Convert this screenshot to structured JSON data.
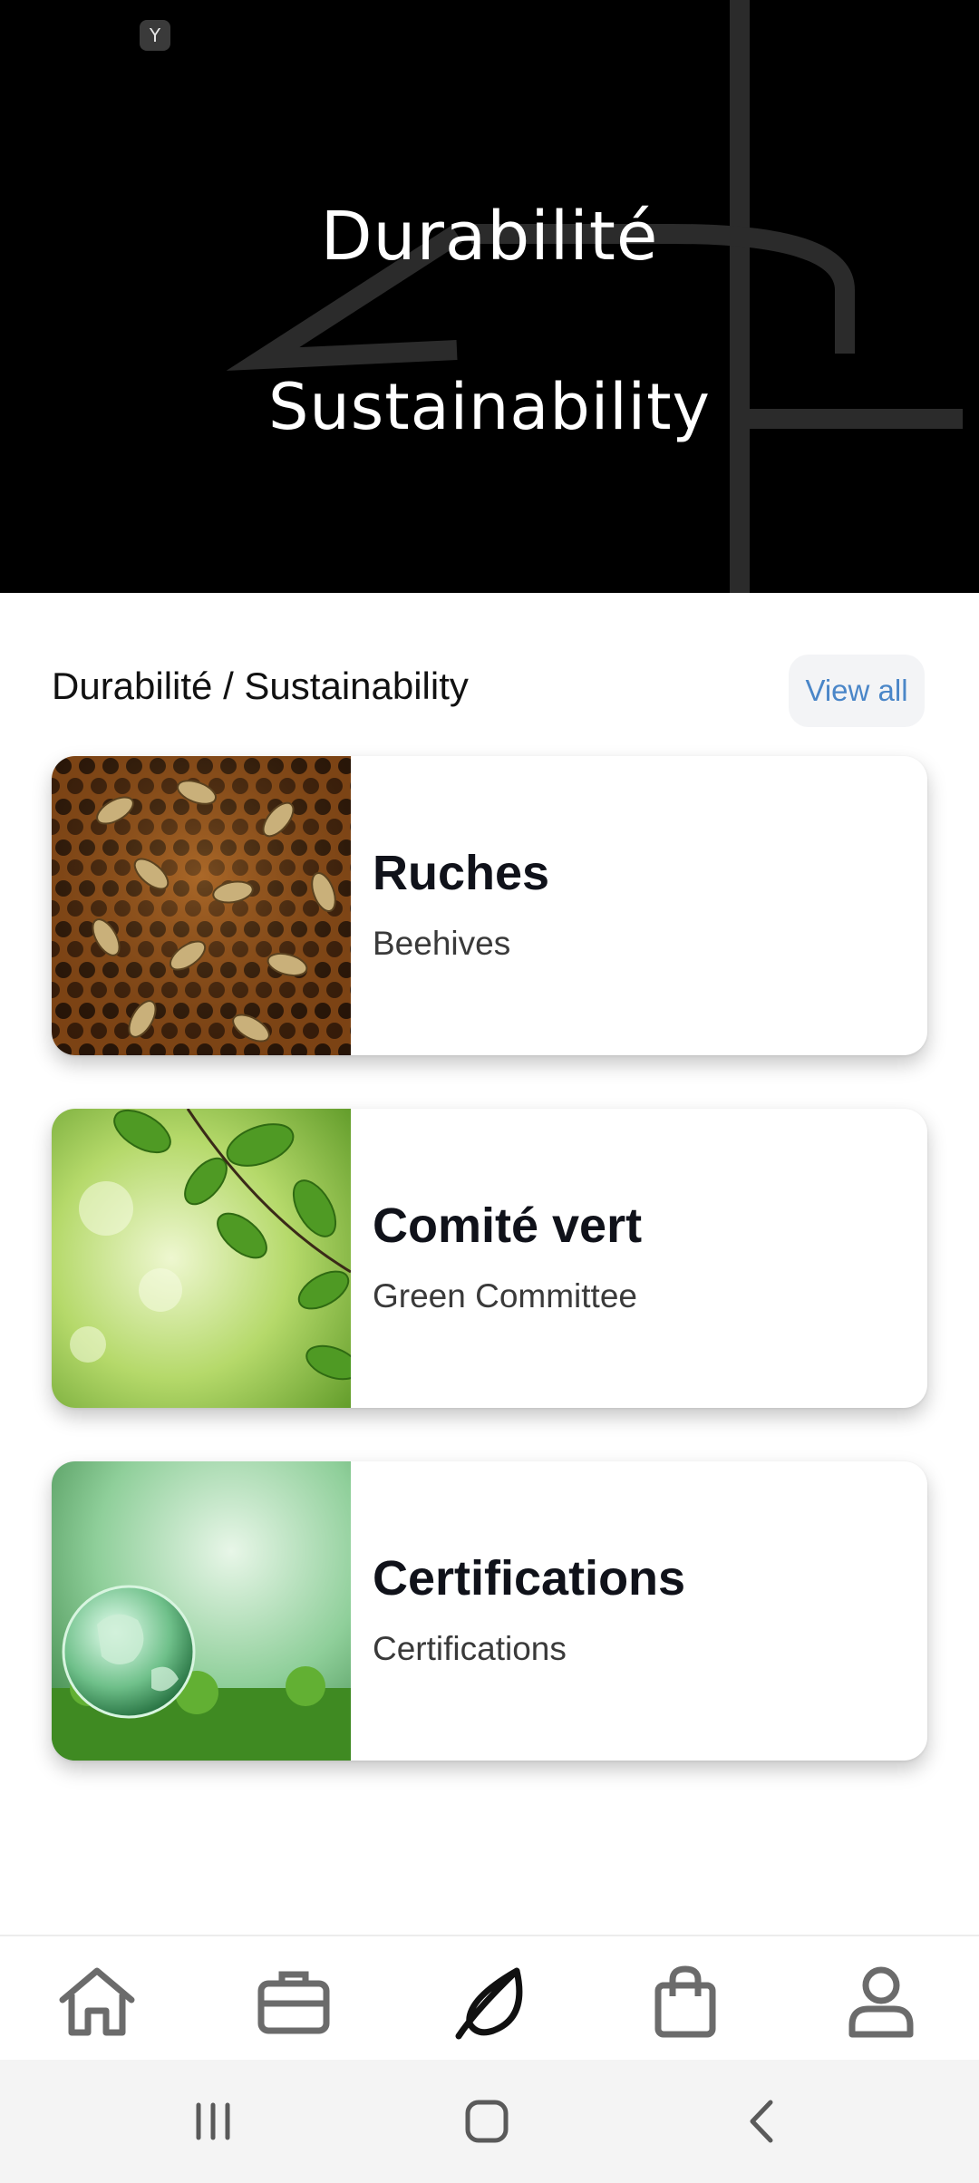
{
  "hero": {
    "title_fr": "Durabilité",
    "title_en": "Sustainability",
    "status_badge": "Y"
  },
  "section": {
    "title": "Durabilité / Sustainability",
    "view_all": "View all"
  },
  "cards": [
    {
      "title": "Ruches",
      "subtitle": "Beehives",
      "image": "honeycomb-bees"
    },
    {
      "title": "Comité vert",
      "subtitle": "Green Committee",
      "image": "green-leaves"
    },
    {
      "title": "Certifications",
      "subtitle": "Certifications",
      "image": "glass-globe-forest"
    }
  ],
  "bottom_nav": {
    "items": [
      {
        "icon": "home-icon",
        "active": false
      },
      {
        "icon": "briefcase-icon",
        "active": false
      },
      {
        "icon": "leaf-icon",
        "active": true
      },
      {
        "icon": "shopping-bag-icon",
        "active": false
      },
      {
        "icon": "profile-icon",
        "active": false
      }
    ]
  },
  "colors": {
    "hero_bg": "#000000",
    "link": "#4a86c8",
    "nav_icon": "#6b6b6b",
    "nav_active": "#111111"
  }
}
